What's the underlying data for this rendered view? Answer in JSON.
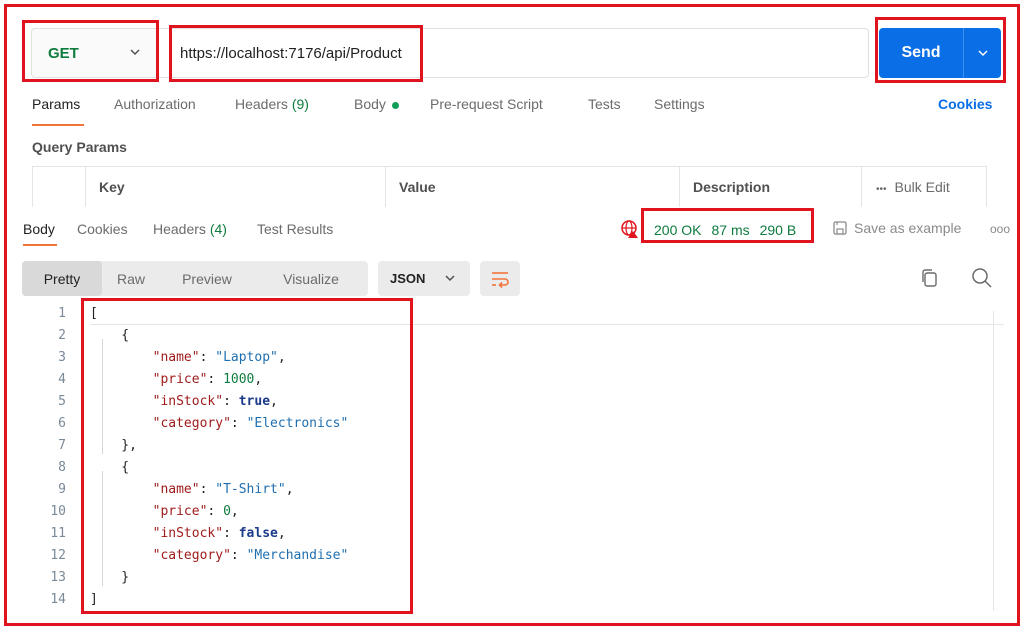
{
  "request": {
    "method": "GET",
    "url": "https://localhost:7176/api/Product",
    "send_label": "Send"
  },
  "request_tabs": [
    {
      "label": "Params"
    },
    {
      "label": "Authorization"
    },
    {
      "label": "Headers",
      "count": "(9)"
    },
    {
      "label": "Body"
    },
    {
      "label": "Pre-request Script"
    },
    {
      "label": "Tests"
    },
    {
      "label": "Settings"
    }
  ],
  "cookies_link": "Cookies",
  "query_params": {
    "title": "Query Params",
    "columns": [
      "Key",
      "Value",
      "Description"
    ],
    "bulk_edit": "Bulk Edit",
    "more": "•••"
  },
  "response_tabs": [
    {
      "label": "Body"
    },
    {
      "label": "Cookies"
    },
    {
      "label": "Headers",
      "count": "(4)"
    },
    {
      "label": "Test Results"
    }
  ],
  "status": {
    "code": "200 OK",
    "time": "87 ms",
    "size": "290 B"
  },
  "save_example": "Save as example",
  "more_response": "ooo",
  "view_modes": [
    "Pretty",
    "Raw",
    "Preview",
    "Visualize"
  ],
  "format": "JSON",
  "code_lines": [
    "1",
    "2",
    "3",
    "4",
    "5",
    "6",
    "7",
    "8",
    "9",
    "10",
    "11",
    "12",
    "13",
    "14"
  ],
  "json": {
    "items": [
      {
        "name": "\"Laptop\"",
        "price": "1000",
        "inStock": "true",
        "category": "\"Electronics\""
      },
      {
        "name": "\"T-Shirt\"",
        "price": "0",
        "inStock": "false",
        "category": "\"Merchandise\""
      }
    ],
    "keys": {
      "name": "\"name\"",
      "price": "\"price\"",
      "inStock": "\"inStock\"",
      "category": "\"category\""
    }
  },
  "colors": {
    "accent": "#f2743a",
    "send": "#0a6ee6",
    "status_ok": "#0f7b3e",
    "highlight": "#e0141e"
  }
}
